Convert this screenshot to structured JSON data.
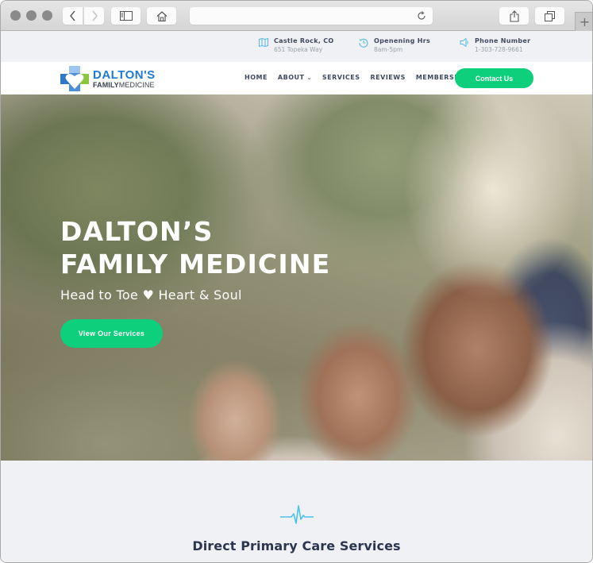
{
  "browser": {
    "address": "",
    "buttons": {
      "back": "back",
      "forward": "forward",
      "sidebar": "sidebar",
      "home": "home",
      "reload": "reload",
      "share": "share",
      "tabs": "tabs",
      "new_tab": "+"
    }
  },
  "infobar": {
    "location": {
      "icon": "map-icon",
      "title": "Castle Rock, CO",
      "sub": "651 Topeka Way"
    },
    "hours": {
      "icon": "clock-icon",
      "title": "Openening Hrs",
      "sub": "8am-5pm"
    },
    "phone": {
      "icon": "phone-icon",
      "title": "Phone Number",
      "sub": "1-303-728-9661"
    }
  },
  "logo": {
    "title": "DALTON'S",
    "sub_bold": "FAMILY",
    "sub_regular": "MEDICINE"
  },
  "nav": {
    "items": [
      {
        "label": "HOME"
      },
      {
        "label": "ABOUT",
        "has_dropdown": true
      },
      {
        "label": "SERVICES"
      },
      {
        "label": "REVIEWS"
      },
      {
        "label": "MEMBERSHIP"
      }
    ],
    "dropdown_caret": "⌄",
    "cta": "Contact Us"
  },
  "hero": {
    "title_line1": "DALTON’S",
    "title_line2": "FAMILY MEDICINE",
    "tagline": "Head to Toe ♥ Heart & Soul",
    "cta": "View Our Services",
    "image_alt": "Smiling family of four outdoors in a park"
  },
  "services": {
    "icon": "heartbeat-icon",
    "title": "Direct Primary Care Services"
  },
  "colors": {
    "accent_green": "#0ed07c",
    "brand_blue": "#1f7bd1",
    "info_icon_blue": "#56b8e6",
    "text_dark": "#2b3650"
  }
}
